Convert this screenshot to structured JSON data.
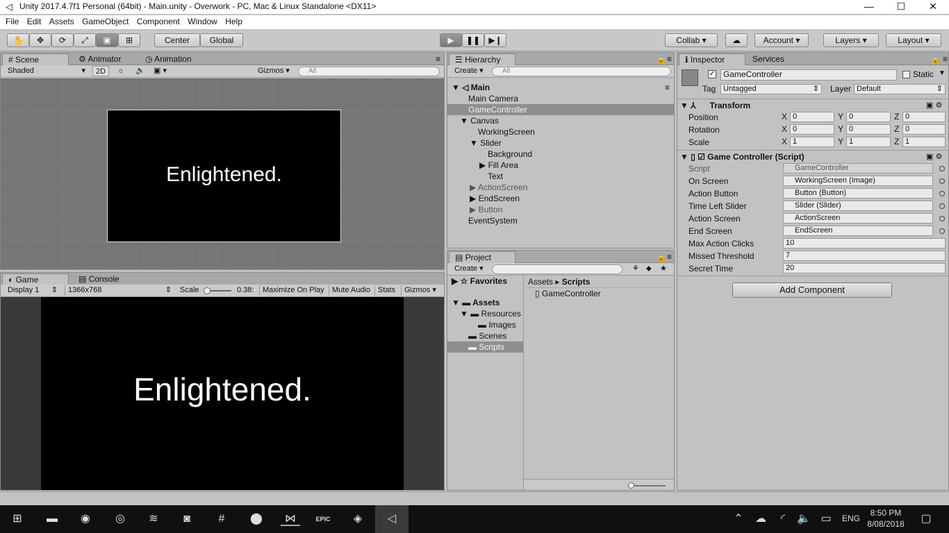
{
  "title": "Unity 2017.4.7f1 Personal (64bit) - Main.unity - Overwork - PC, Mac & Linux Standalone <DX11>",
  "window_controls": {
    "minimize": "—",
    "maximize": "☐",
    "close": "✕"
  },
  "menu": [
    "File",
    "Edit",
    "Assets",
    "GameObject",
    "Component",
    "Window",
    "Help"
  ],
  "toolbar": {
    "pivot": "Center",
    "space": "Global",
    "collab": "Collab",
    "account": "Account",
    "layers": "Layers",
    "layout": "Layout"
  },
  "scene": {
    "tabs": [
      "Scene",
      "Animator",
      "Animation"
    ],
    "shading": "Shaded",
    "mode_2d": "2D",
    "gizmos": "Gizmos",
    "search_placeholder": "All",
    "canvas_text": "Enlightened."
  },
  "game": {
    "tabs": [
      "Game",
      "Console"
    ],
    "display": "Display 1",
    "resolution": "1366x768",
    "scale_label": "Scale",
    "scale_value": "0.38:",
    "maximize_on_play": "Maximize On Play",
    "mute_audio": "Mute Audio",
    "stats": "Stats",
    "gizmos": "Gizmos",
    "canvas_text": "Enlightened."
  },
  "hierarchy": {
    "tab": "Hierarchy",
    "create": "Create",
    "search_placeholder": "All",
    "scene_name": "Main",
    "items": [
      {
        "label": "Main Camera"
      },
      {
        "label": "GameController"
      },
      {
        "label": "Canvas"
      },
      {
        "label": "WorkingScreen"
      },
      {
        "label": "Slider"
      },
      {
        "label": "Background"
      },
      {
        "label": "Fill Area"
      },
      {
        "label": "Text"
      },
      {
        "label": "ActionScreen"
      },
      {
        "label": "EndScreen"
      },
      {
        "label": "Button"
      },
      {
        "label": "EventSystem"
      }
    ]
  },
  "project": {
    "tab": "Project",
    "create": "Create",
    "favorites": "Favorites",
    "assets": "Assets",
    "folders": [
      "Resources",
      "Images",
      "Scenes",
      "Scripts"
    ],
    "breadcrumb": [
      "Assets",
      "Scripts"
    ],
    "files": [
      "GameController"
    ]
  },
  "inspector": {
    "tabs": [
      "Inspector",
      "Services"
    ],
    "object_name": "GameController",
    "static_label": "Static",
    "tag_label": "Tag",
    "tag_value": "Untagged",
    "layer_label": "Layer",
    "layer_value": "Default",
    "transform": {
      "title": "Transform",
      "position_label": "Position",
      "rotation_label": "Rotation",
      "scale_label": "Scale",
      "position": [
        "0",
        "0",
        "0"
      ],
      "rotation": [
        "0",
        "0",
        "0"
      ],
      "scale": [
        "1",
        "1",
        "1"
      ]
    },
    "script_component": {
      "title": "Game Controller (Script)",
      "fields": [
        {
          "label": "Script",
          "value": "GameController"
        },
        {
          "label": "On Screen",
          "value": "WorkingScreen (Image)"
        },
        {
          "label": "Action Button",
          "value": "Button (Button)"
        },
        {
          "label": "Time Left Slider",
          "value": "Slider (Slider)"
        },
        {
          "label": "Action Screen",
          "value": "ActionScreen"
        },
        {
          "label": "End Screen",
          "value": "EndScreen"
        },
        {
          "label": "Max Action Clicks",
          "value": "10"
        },
        {
          "label": "Missed Threshold",
          "value": "7"
        },
        {
          "label": "Secret Time",
          "value": "20"
        }
      ]
    },
    "add_component": "Add Component"
  },
  "taskbar": {
    "language": "ENG",
    "time": "8:50 PM",
    "date": "8/08/2018",
    "epic_label": "EPIC"
  }
}
